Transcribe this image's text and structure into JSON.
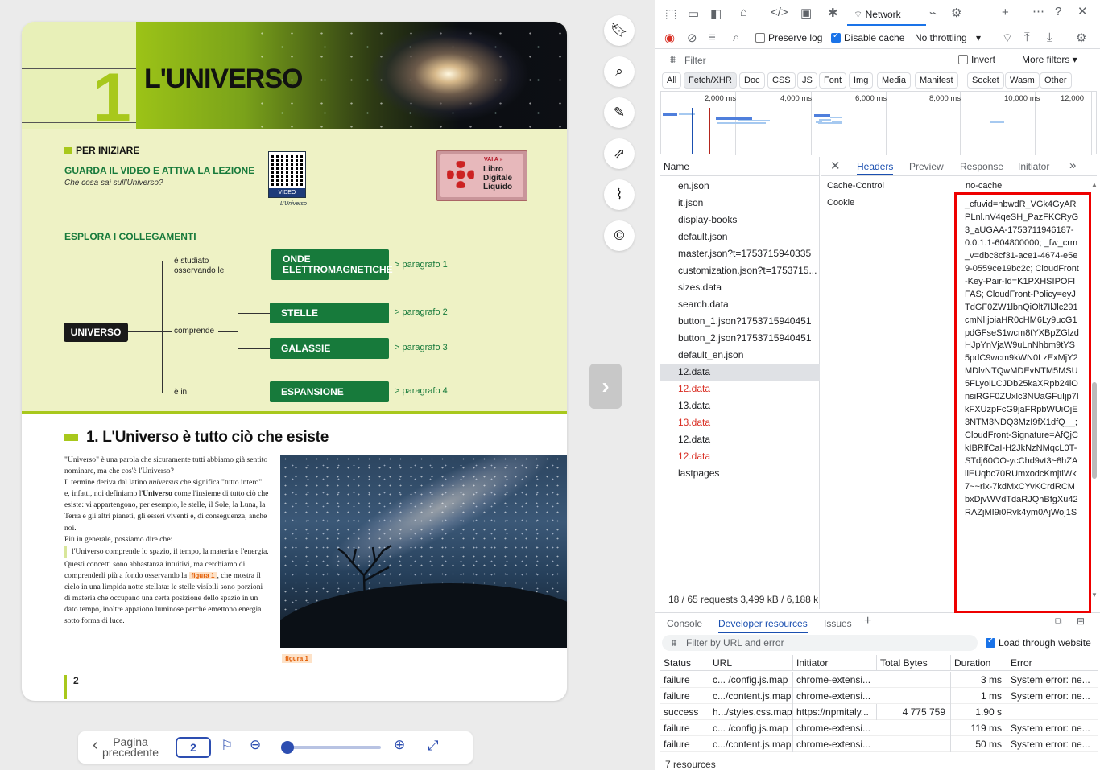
{
  "book": {
    "chapter_number": "1",
    "chapter_title": "L'UNIVERSO",
    "per_iniziare": "PER INIZIARE",
    "video_heading": "GUARDA IL VIDEO E ATTIVA LA LEZIONE",
    "video_sub": "Che cosa sai sull'Universo?",
    "qr_label": "VIDEO",
    "qr_caption": "L'Universo",
    "ldl_vai": "VAI A »",
    "ldl_l1": "Libro",
    "ldl_l2": "Digitale",
    "ldl_l3": "Liquido",
    "explore_heading": "ESPLORA I COLLEGAMENTI",
    "map": {
      "root": "UNIVERSO",
      "studiato": "è studiato\nosservando le",
      "comprende": "comprende",
      "ein": "è in",
      "box_onde_1": "ONDE",
      "box_onde_2": "ELETTROMAGNETICHE",
      "box_stelle": "STELLE",
      "box_galassie": "GALASSIE",
      "box_espansione": "ESPANSIONE",
      "par1": "> paragrafo 1",
      "par2": "> paragrafo 2",
      "par3": "> paragrafo 3",
      "par4": "> paragrafo 4"
    },
    "section_title": "1. L'Universo è tutto ciò che esiste",
    "body": {
      "p1": "\"Universo\" è una parola che sicuramente tutti abbiamo già sentito nominare, ma che cos'è l'Universo?",
      "p2a": "Il termine deriva dal latino ",
      "p2b": "universus",
      "p2c": " che significa \"tutto intero\" e, infatti, noi definiamo l'",
      "p2d": "Universo",
      "p2e": " come l'insieme di tutto ciò che esiste: vi appartengono, per esempio, le stelle, il Sole, la Luna, la Terra e gli altri pianeti, gli esseri viventi e, di conseguenza, anche noi.",
      "p3": "Più in generale, possiamo dire che:",
      "quote": "l'Universo comprende lo spazio, il tempo, la materia e l'energia.",
      "p4a": "Questi concetti sono abbastanza intuitivi, ma cerchiamo di comprenderli più a fondo osservando la ",
      "p4b": "figura 1",
      "p4c": ", che mostra il cielo in una limpida notte stellata: le stelle visibili sono porzioni di materia che occupano una certa posizione dello spazio in un dato tempo, inoltre appaiono luminose perché emettono energia sotto forma di luce."
    },
    "figure_caption": "figura 1",
    "page_number": "2"
  },
  "viewer": {
    "prev_label_1": "Pagina",
    "prev_label_2": "precedente",
    "page_value": "2",
    "zoom_level": 0.02
  },
  "devtools": {
    "active_tab": "Network",
    "preserve_log": "Preserve log",
    "disable_cache": "Disable cache",
    "throttling": "No throttling",
    "filter_placeholder": "Filter",
    "invert": "Invert",
    "more_filters": "More filters",
    "chips": [
      "All",
      "Fetch/XHR",
      "Doc",
      "CSS",
      "JS",
      "Font",
      "Img",
      "Media",
      "Manifest",
      "Socket",
      "Wasm",
      "Other"
    ],
    "timeline_ticks": [
      "2,000 ms",
      "4,000 ms",
      "6,000 ms",
      "8,000 ms",
      "10,000 ms",
      "12,000"
    ],
    "name_header": "Name",
    "requests": [
      {
        "name": "en.json",
        "error": false
      },
      {
        "name": "it.json",
        "error": false
      },
      {
        "name": "display-books",
        "error": false
      },
      {
        "name": "default.json",
        "error": false
      },
      {
        "name": "master.json?t=1753715940335",
        "error": false
      },
      {
        "name": "customization.json?t=1753715...",
        "error": false
      },
      {
        "name": "sizes.data",
        "error": false
      },
      {
        "name": "search.data",
        "error": false
      },
      {
        "name": "button_1.json?1753715940451",
        "error": false
      },
      {
        "name": "button_2.json?1753715940451",
        "error": false
      },
      {
        "name": "default_en.json",
        "error": false
      },
      {
        "name": "12.data",
        "error": false,
        "selected": true
      },
      {
        "name": "12.data",
        "error": true
      },
      {
        "name": "13.data",
        "error": false
      },
      {
        "name": "13.data",
        "error": true
      },
      {
        "name": "12.data",
        "error": false
      },
      {
        "name": "12.data",
        "error": true
      },
      {
        "name": "lastpages",
        "error": false
      }
    ],
    "summary": "18 / 65 requests  3,499 kB / 6,188 k",
    "detail_tabs": [
      "Headers",
      "Preview",
      "Response",
      "Initiator"
    ],
    "headers": {
      "cache_control_key": "Cache-Control",
      "cache_control_val": "no-cache",
      "cookie_key": "Cookie",
      "cookie_val": "_cfuvid=nbwdR_VGk4GyARPLnl.nV4qeSH_PazFKCRyG3_aUGAA-1753711946187-0.0.1.1-604800000; _fw_crm_v=dbc8cf31-ace1-4674-e5e9-0559ce19bc2c; CloudFront-Key-Pair-Id=K1PXHSIPOFIFAS; CloudFront-Policy=eyJTdGF0ZW1lbnQiOlt7IlJlc291cmNlIjoiaHR0cHM6Ly9ucG1pdGFseS1wcm8tYXBpZGlzdHJpYnVjaW9uLnNhbm9tYS5pdC9wcm9kWN0LzExMjY2MDlvNTQwMDEvNTM5MSU5FLyoiLCJDb25kaXRpb24iOnsiRGF0ZUxlc3NUaGFuIjp7IkFXUzpFcG9jaFRpbWUiOjE3NTM3NDQ3MzI9fX1dfQ__; CloudFront-Signature=AfQjCkIBRlfCaI-H2JkNzNMqcL0T-STdj60OO-ycChd9vt3~8hZAliEUqbc70RUmxodcKmjtlWk7~~rix-7kdMxCYvKCrdRCMbxDjvWVdTdaRJQhBfgXu42RAZjMI9i0Rvk4ym0AjWoj1S"
    },
    "drawer_tabs": [
      "Console",
      "Developer resources",
      "Issues"
    ],
    "drawer_filter": "Filter by URL and error",
    "load_through": "Load through website",
    "resources_headers": [
      "Status",
      "URL",
      "Initiator",
      "Total Bytes",
      "Duration",
      "Error"
    ],
    "resources": [
      {
        "status": "failure",
        "url": "c... /config.js.map",
        "initiator": "chrome-extensi...",
        "bytes": "",
        "duration": "3 ms",
        "error": "System error: ne..."
      },
      {
        "status": "failure",
        "url": "c.../content.js.map",
        "initiator": "chrome-extensi...",
        "bytes": "",
        "duration": "1 ms",
        "error": "System error: ne..."
      },
      {
        "status": "success",
        "url": "h.../styles.css.map",
        "initiator": "https://npmitaly...",
        "bytes": "4 775 759",
        "duration": "1.90 s",
        "error": ""
      },
      {
        "status": "failure",
        "url": "c... /config.js.map",
        "initiator": "chrome-extensi...",
        "bytes": "",
        "duration": "119 ms",
        "error": "System error: ne..."
      },
      {
        "status": "failure",
        "url": "c.../content.js.map",
        "initiator": "chrome-extensi...",
        "bytes": "",
        "duration": "50 ms",
        "error": "System error: ne..."
      }
    ],
    "resources_count": "7 resources"
  }
}
